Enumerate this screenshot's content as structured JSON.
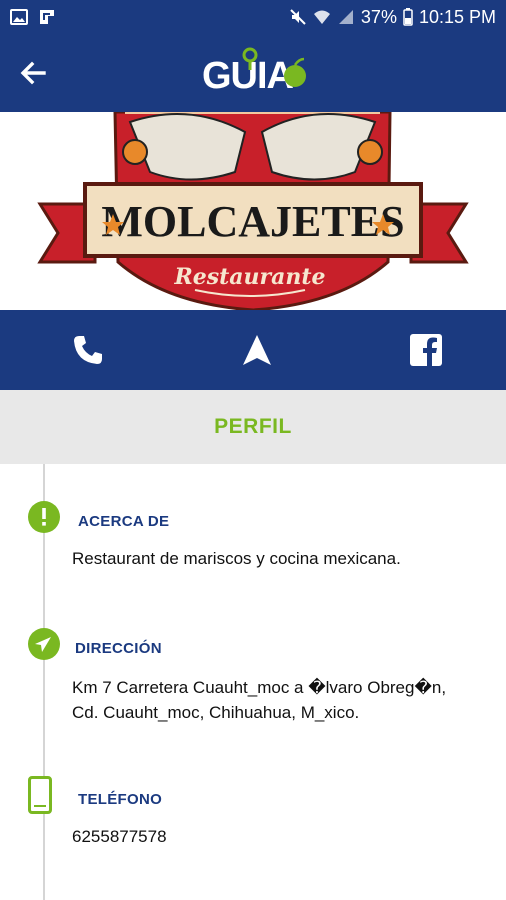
{
  "status_bar": {
    "battery": "37%",
    "time": "10:15 PM",
    "icons": [
      "image-icon",
      "flipboard-icon",
      "mute-icon",
      "wifi-icon",
      "signal-icon",
      "battery-icon"
    ]
  },
  "app_bar": {
    "logo_text": "GUIA",
    "back_icon": "arrow-back-icon"
  },
  "banner": {
    "title": "MOLCAJETES",
    "subtitle": "Restaurante"
  },
  "actions": [
    {
      "icon": "phone-icon"
    },
    {
      "icon": "navigation-icon"
    },
    {
      "icon": "facebook-icon"
    }
  ],
  "tab": {
    "label": "PERFIL"
  },
  "sections": {
    "about": {
      "heading": "ACERCA DE",
      "text": "Restaurant de mariscos y cocina mexicana."
    },
    "address": {
      "heading": "DIRECCIÓN",
      "line1": "Km 7  Carretera Cuauht_moc a �lvaro Obreg�n,",
      "line2": "Cd. Cuauht_moc, Chihuahua, M_xico."
    },
    "phone": {
      "heading": "TELÉFONO",
      "text": "6255877578"
    }
  },
  "colors": {
    "primary": "#1b3a80",
    "accent_green": "#7ab821",
    "tab_bg": "#e8e8e8",
    "banner_red": "#c8202a"
  }
}
